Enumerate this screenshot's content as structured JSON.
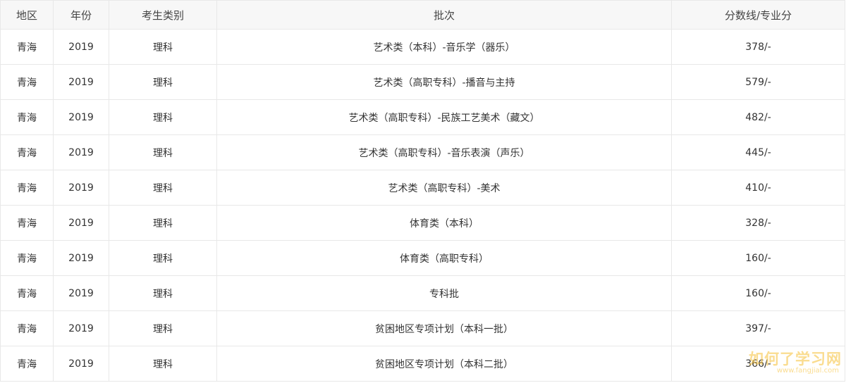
{
  "table": {
    "headers": [
      "地区",
      "年份",
      "考生类别",
      "批次",
      "分数线/专业分"
    ],
    "rows": [
      [
        "青海",
        "2019",
        "理科",
        "艺术类（本科）-音乐学（器乐）",
        "378/-"
      ],
      [
        "青海",
        "2019",
        "理科",
        "艺术类（高职专科）-播音与主持",
        "579/-"
      ],
      [
        "青海",
        "2019",
        "理科",
        "艺术类（高职专科）-民族工艺美术（藏文）",
        "482/-"
      ],
      [
        "青海",
        "2019",
        "理科",
        "艺术类（高职专科）-音乐表演（声乐）",
        "445/-"
      ],
      [
        "青海",
        "2019",
        "理科",
        "艺术类（高职专科）-美术",
        "410/-"
      ],
      [
        "青海",
        "2019",
        "理科",
        "体育类（本科）",
        "328/-"
      ],
      [
        "青海",
        "2019",
        "理科",
        "体育类（高职专科）",
        "160/-"
      ],
      [
        "青海",
        "2019",
        "理科",
        "专科批",
        "160/-"
      ],
      [
        "青海",
        "2019",
        "理科",
        "贫困地区专项计划（本科一批）",
        "397/-"
      ],
      [
        "青海",
        "2019",
        "理科",
        "贫困地区专项计划（本科二批）",
        "366/-"
      ]
    ]
  },
  "watermark": {
    "main": "如何了学习网",
    "sub": "www.fangjial.com"
  }
}
